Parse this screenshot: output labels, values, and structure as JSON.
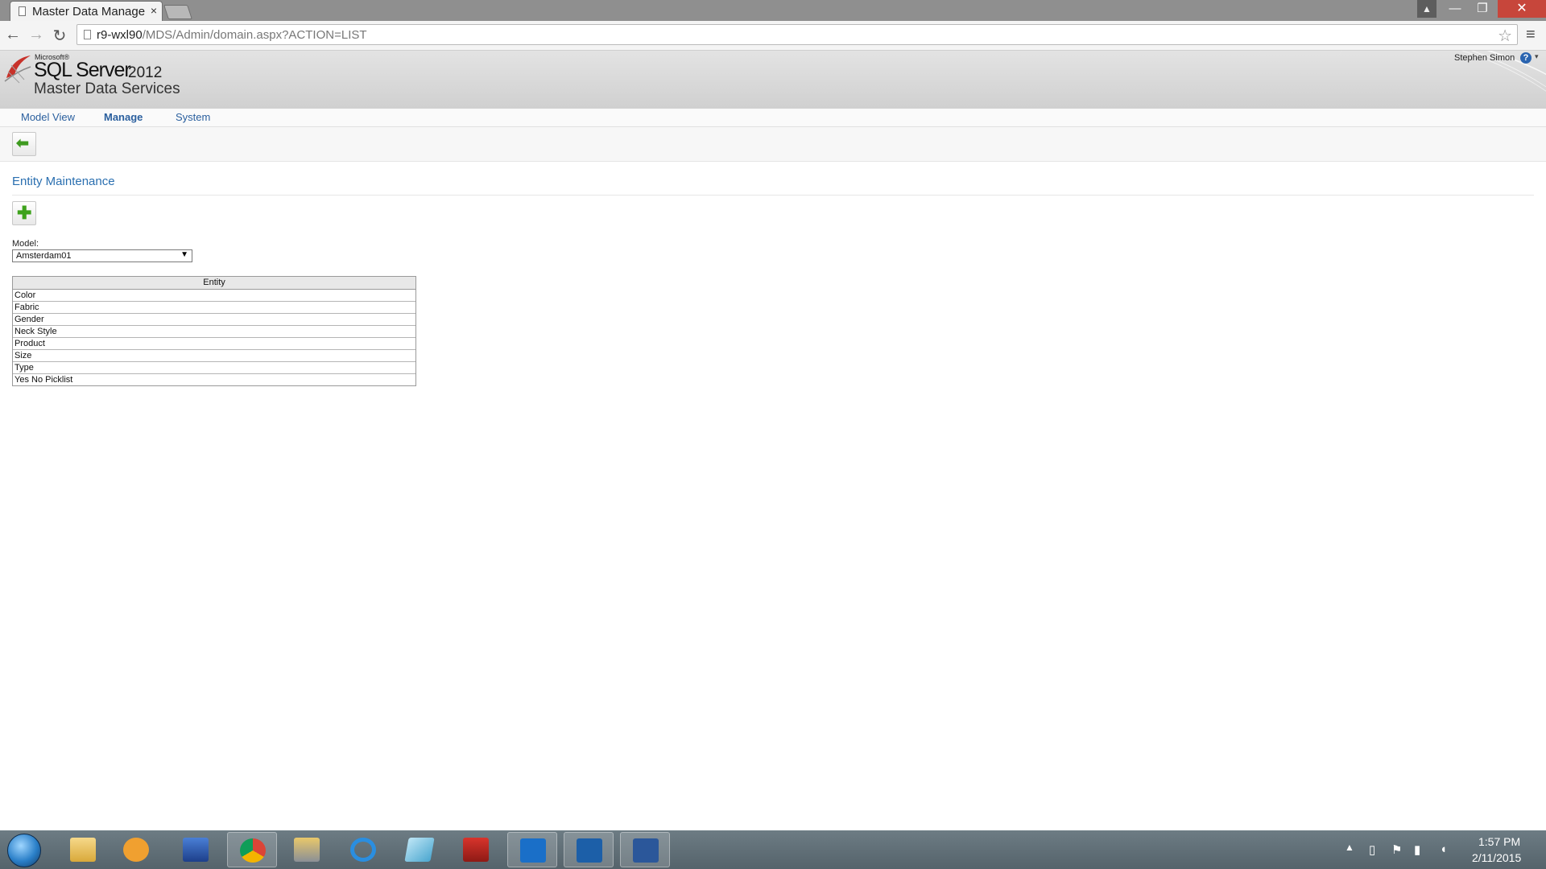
{
  "browser": {
    "tab_title": "Master Data Manage",
    "tab_close": "×",
    "url_host": "r9-wxl90",
    "url_path": "/MDS/Admin/domain.aspx?ACTION=LIST",
    "nav_back": "←",
    "nav_forward": "→",
    "reload": "↻",
    "star": "☆",
    "menu": "≡",
    "win_minimize": "—",
    "win_maximize": "❐",
    "win_close": "✕",
    "win_user": "▲"
  },
  "header": {
    "microsoft": "Microsoft®",
    "product": "SQL Server",
    "version": "2012",
    "subtitle": "Master Data Services",
    "user": "Stephen Simon",
    "help": "?",
    "help_caret": "▾"
  },
  "nav": {
    "model_view": "Model View",
    "manage": "Manage",
    "system": "System"
  },
  "toolbar": {
    "back_symbol": "⬅"
  },
  "main": {
    "title": "Entity Maintenance",
    "add_symbol": "✚",
    "model_label": "Model:",
    "model_value": "Amsterdam01",
    "select_arrow": "▼",
    "table_header": "Entity",
    "entities": [
      "Color",
      "Fabric",
      "Gender",
      "Neck Style",
      "Product",
      "Size",
      "Type",
      "Yes No Picklist"
    ]
  },
  "taskbar": {
    "items": [
      "file-explorer",
      "media-player",
      "remote-desktop",
      "chrome",
      "tools",
      "internet-explorer",
      "notepad",
      "toolbox",
      "lync",
      "outlook",
      "word"
    ],
    "active": "chrome",
    "tray_up": "▲",
    "time": "1:57 PM",
    "date": "2/11/2015"
  },
  "colors": {
    "link_blue": "#2a5f9e",
    "title_blue": "#2a6fb0",
    "add_green": "#3ea21c",
    "close_red": "#c7463b"
  }
}
